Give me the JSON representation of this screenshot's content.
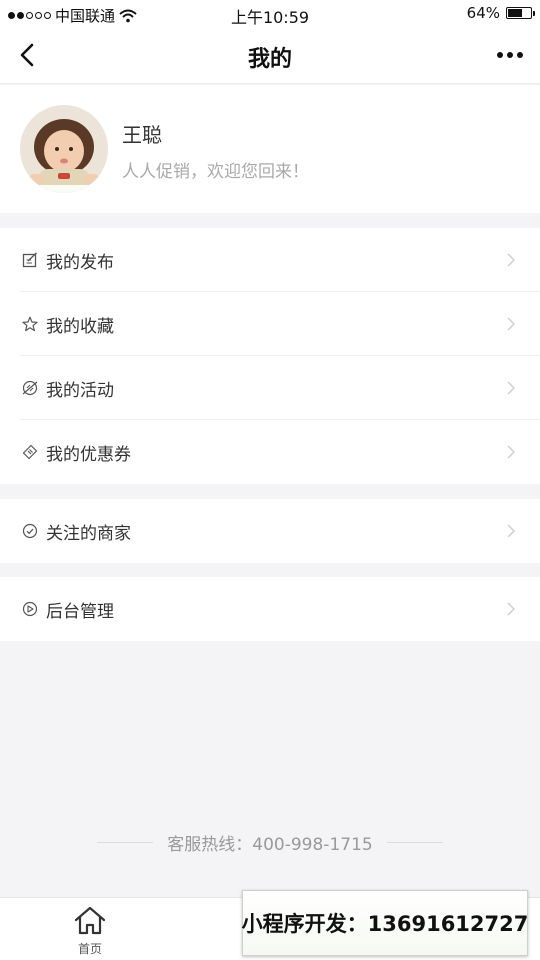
{
  "status_bar": {
    "carrier": "中国联通",
    "time": "上午10:59",
    "battery": "64%",
    "battery_level": 0.64
  },
  "nav": {
    "title": "我的"
  },
  "profile": {
    "name": "王聪",
    "welcome": "人人促销，欢迎您回来！"
  },
  "menu_groups": [
    {
      "items": [
        {
          "label": "我的发布",
          "icon": "edit-icon"
        },
        {
          "label": "我的收藏",
          "icon": "star-icon"
        },
        {
          "label": "我的活动",
          "icon": "activity-icon"
        },
        {
          "label": "我的优惠券",
          "icon": "coupon-icon"
        }
      ]
    },
    {
      "items": [
        {
          "label": "关注的商家",
          "icon": "check-circle-icon"
        }
      ]
    },
    {
      "items": [
        {
          "label": "后台管理",
          "icon": "dashboard-icon"
        }
      ]
    }
  ],
  "hotline": "客服热线：400-998-1715",
  "tab_bar": {
    "home_label": "首页"
  },
  "ad": {
    "text": "小程序开发：13691612727"
  }
}
